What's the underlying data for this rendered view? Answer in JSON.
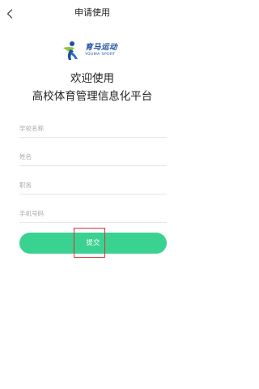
{
  "header": {
    "title": "申请使用",
    "back_icon": "chevron-left-icon"
  },
  "logo": {
    "name_cn": "育马运动",
    "name_en": "YOUMA SPORT",
    "icon": "runner-logo-icon"
  },
  "headline": {
    "line1": "欢迎使用",
    "line2": "高校体育管理信息化平台"
  },
  "form": {
    "school_placeholder": "学校名称",
    "name_placeholder": "姓名",
    "position_placeholder": "职务",
    "phone_placeholder": "手机号码",
    "submit_label": "提交"
  },
  "colors": {
    "accent": "#3ad290",
    "logo_blue": "#1f4fa0",
    "logo_green": "#8cc63f",
    "highlight": "#e0303a"
  }
}
